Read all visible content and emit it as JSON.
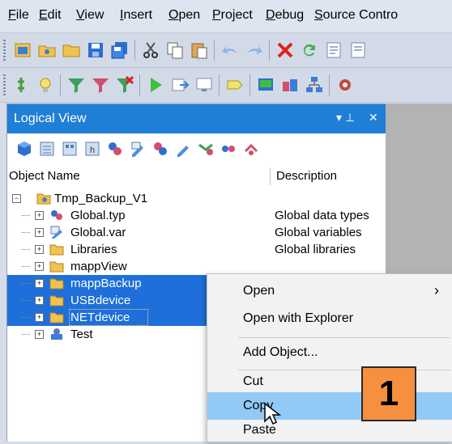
{
  "menu": {
    "items": [
      {
        "mn": "F",
        "rest": "ile"
      },
      {
        "mn": "E",
        "rest": "dit"
      },
      {
        "mn": "V",
        "rest": "iew"
      },
      {
        "mn": "I",
        "rest": "nsert"
      },
      {
        "mn": "O",
        "rest": "pen"
      },
      {
        "mn": "P",
        "rest": "roject"
      },
      {
        "mn": "D",
        "rest": "ebug"
      },
      {
        "mn": "S",
        "rest": "ource Contro"
      }
    ]
  },
  "panel": {
    "title": "Logical View",
    "pin_glyph": "▾ ⊥",
    "close_glyph": "✕",
    "col_name": "Object Name",
    "col_desc": "Description"
  },
  "tree": {
    "root": "Tmp_Backup_V1",
    "rows": [
      {
        "name": "Global.typ",
        "desc": "Global data types",
        "icon": "type-icon"
      },
      {
        "name": "Global.var",
        "desc": "Global variables",
        "icon": "variable-icon"
      },
      {
        "name": "Libraries",
        "desc": "Global libraries",
        "icon": "folder-icon"
      },
      {
        "name": "mappView",
        "desc": "",
        "icon": "folder-icon"
      },
      {
        "name": "mappBackup",
        "desc": "",
        "icon": "folder-icon"
      },
      {
        "name": "USBdevice",
        "desc": "",
        "icon": "folder-icon"
      },
      {
        "name": "NETdevice",
        "desc": "",
        "icon": "folder-icon"
      },
      {
        "name": "Test",
        "desc": "",
        "icon": "program-icon"
      }
    ]
  },
  "context_menu": {
    "open": "Open",
    "open_arrow": "›",
    "open_explorer": "Open with Explorer",
    "add_object": "Add Object...",
    "cut": "Cut",
    "copy": "Copy",
    "paste": "Paste"
  },
  "callout": {
    "number": "1"
  },
  "colors": {
    "selection": "#1e6fd9",
    "title_bar": "#1f7fd6",
    "hover": "#91c9f7",
    "badge": "#f5913e"
  }
}
